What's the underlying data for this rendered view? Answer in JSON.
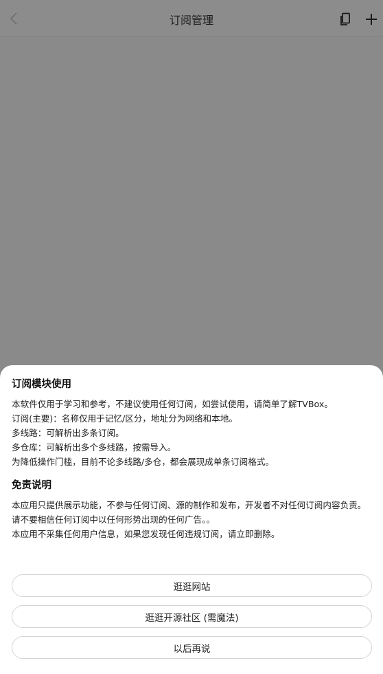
{
  "header": {
    "title": "订阅管理",
    "back_icon": "chevron-left-icon",
    "copy_icon": "copy-icon",
    "add_icon": "plus-icon"
  },
  "dialog": {
    "section1_title": "订阅模块使用",
    "section1_lines": [
      "本软件仅用于学习和参考，不建议使用任何订阅，如尝试使用，请简单了解TVBox。",
      "订阅(主要)：名称仅用于记忆/区分，地址分为网络和本地。",
      "多线路：可解析出多条订阅。",
      "多仓库：可解析出多个多线路，按需导入。",
      "为降低操作门槛，目前不论多线路/多仓，都会展现成单条订阅格式。"
    ],
    "section2_title": "免责说明",
    "section2_lines": [
      "本应用只提供展示功能，不参与任何订阅、源的制作和发布，开发者不对任何订阅内容负责。",
      "请不要相信任何订阅中以任何形势出现的任何广告。。",
      "本应用不采集任何用户信息，如果您发现任何违规订阅，请立即删除。"
    ],
    "buttons": {
      "visit_site": "逛逛网站",
      "visit_community": "逛逛开源社区 (需魔法)",
      "later": "以后再说"
    }
  },
  "colors": {
    "overlay": "#8a8a8a",
    "sheet": "#ffffff",
    "text": "#222222"
  }
}
